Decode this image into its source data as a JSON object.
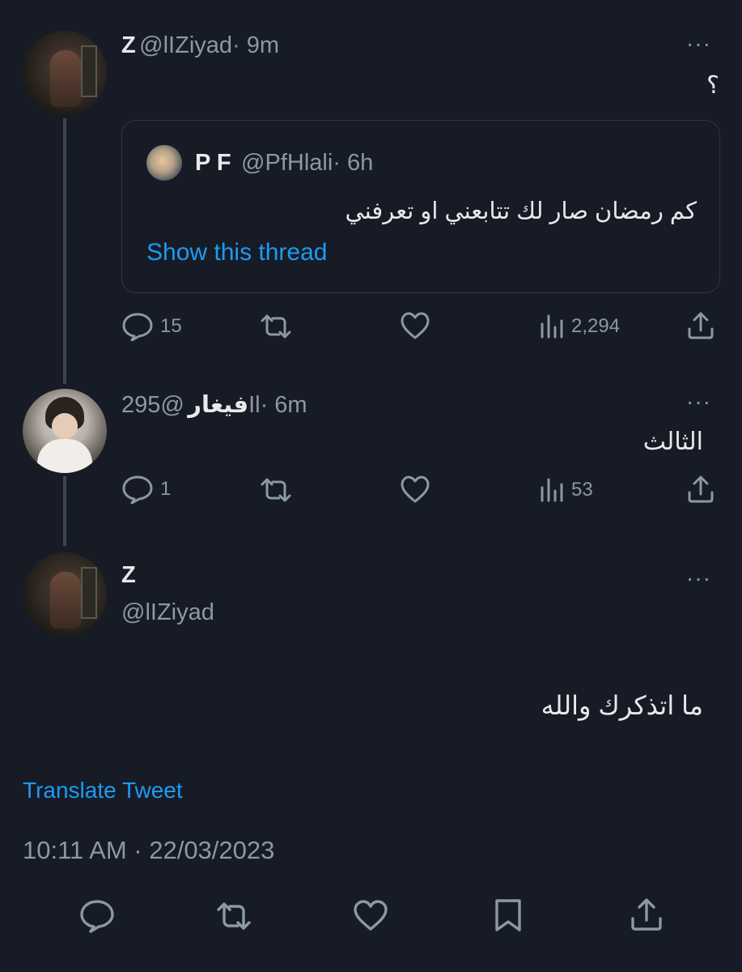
{
  "tweet1": {
    "name": "Z",
    "handle": "@lIZiyad",
    "time": "· 9m",
    "text": "؟",
    "more": "···",
    "quote": {
      "name": "P F",
      "handle": "@PfHlali",
      "time": "· 6h",
      "text": "كم رمضان صار لك تتابعني او تعرفني",
      "show_thread": "Show this thread"
    },
    "actions": {
      "replies": "15",
      "views": "2,294"
    }
  },
  "tweet2": {
    "name": "فيغار",
    "handle": "@295Il",
    "time": "· 6m",
    "text": "الثالث",
    "more": "···",
    "actions": {
      "replies": "1",
      "views": "53"
    }
  },
  "main_tweet": {
    "name": "Z",
    "handle": "@lIZiyad",
    "more": "···",
    "text": "ما اتذكرك والله",
    "translate": "Translate Tweet",
    "timestamp": "10:11 AM · 22/03/2023"
  },
  "icons": [
    "reply-icon",
    "retweet-icon",
    "like-icon",
    "views-icon",
    "share-icon",
    "bookmark-icon",
    "more-icon"
  ],
  "colors": {
    "background": "#161b26",
    "text": "#e7e9ea",
    "muted": "#8b98a5",
    "link": "#1d9bf0"
  }
}
